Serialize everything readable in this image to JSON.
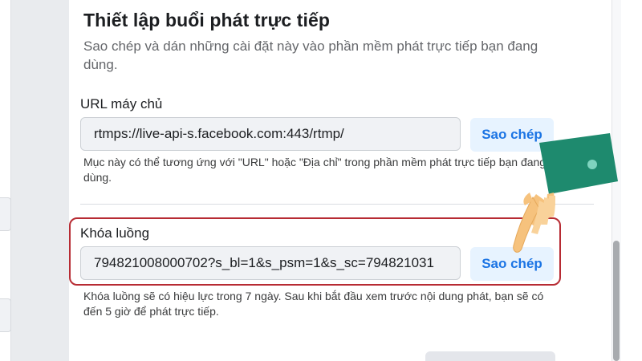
{
  "panel": {
    "title": "Thiết lập buổi phát trực tiếp",
    "subtitle": "Sao chép và dán những cài đặt này vào phần mềm phát trực tiếp bạn đang dùng."
  },
  "server_url": {
    "label": "URL máy chủ",
    "value": "rtmps://live-api-s.facebook.com:443/rtmp/",
    "copy_label": "Sao chép",
    "help": "Mục này có thể tương ứng với \"URL\" hoặc \"Địa chỉ\" trong phần mềm phát trực tiếp bạn đang dùng."
  },
  "stream_key": {
    "label": "Khóa luồng",
    "value": "794821008000702?s_bl=1&s_psm=1&s_sc=794821031",
    "copy_label": "Sao chép",
    "help": "Khóa luồng sẽ có hiệu lực trong 7 ngày. Sau khi bắt đầu xem trước nội dung phát, bạn sẽ có đến 5 giờ để phát trực tiếp."
  },
  "colors": {
    "accent": "#1b74e4",
    "copy_button_bg": "#e7f3ff",
    "highlight_border": "#b72b33",
    "hand_skin": "#f6c27d",
    "hand_sleeve": "#1e8a6e"
  }
}
